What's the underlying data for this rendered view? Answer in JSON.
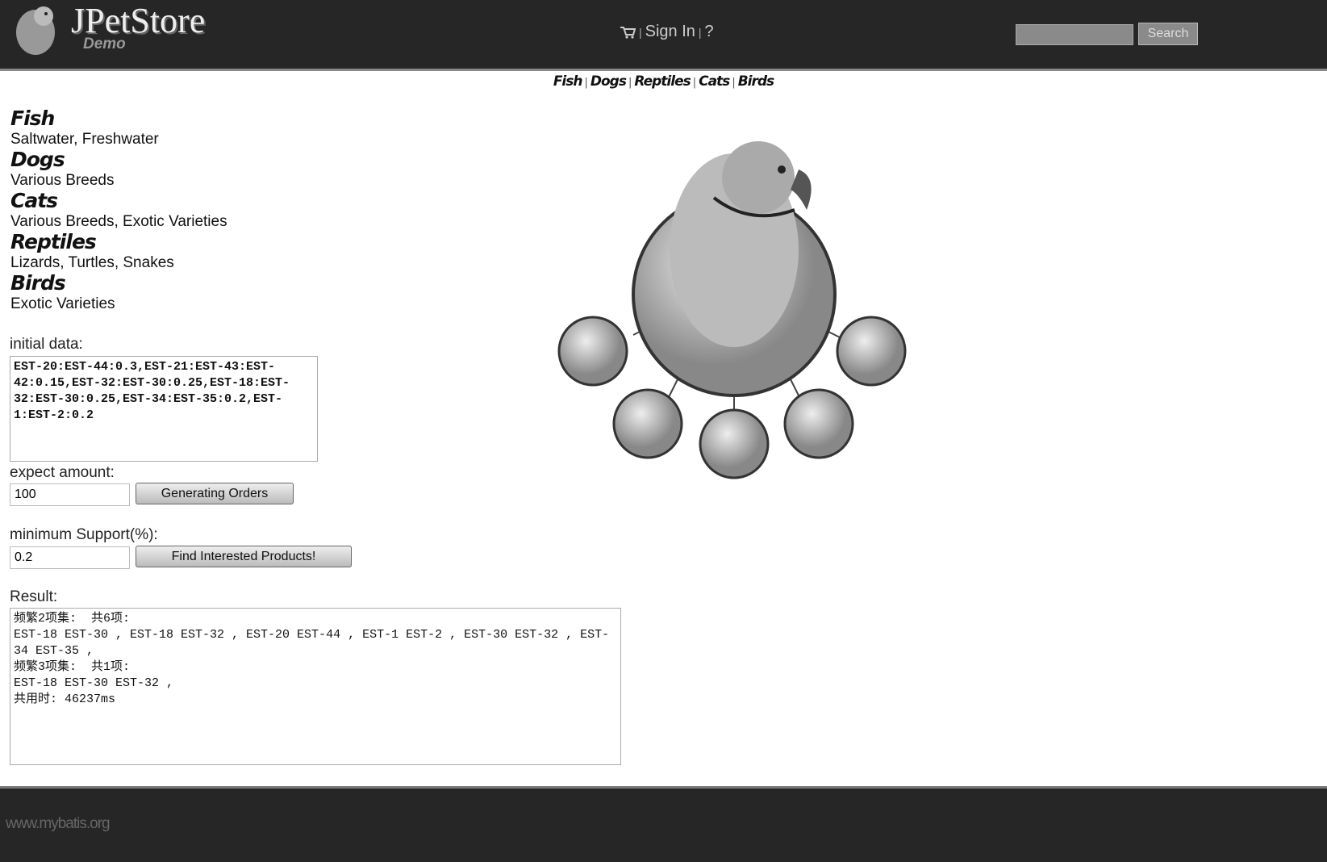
{
  "header": {
    "title": "JPetStore",
    "subtitle": "Demo",
    "cart_icon": "cart-icon",
    "sign_in": "Sign In",
    "help": "?",
    "sep": "|",
    "search_placeholder": "",
    "search_button": "Search"
  },
  "nav": {
    "links": [
      "Fish",
      "Dogs",
      "Reptiles",
      "Cats",
      "Birds"
    ],
    "sep": "|"
  },
  "categories": [
    {
      "name": "Fish",
      "desc": "Saltwater, Freshwater"
    },
    {
      "name": "Dogs",
      "desc": "Various Breeds"
    },
    {
      "name": "Cats",
      "desc": "Various Breeds, Exotic Varieties"
    },
    {
      "name": "Reptiles",
      "desc": "Lizards, Turtles, Snakes"
    },
    {
      "name": "Birds",
      "desc": "Exotic Varieties"
    }
  ],
  "form": {
    "initial_label": "initial data:",
    "initial_value": "EST-20:EST-44:0.3,EST-21:EST-43:EST-42:0.15,EST-32:EST-30:0.25,EST-18:EST-32:EST-30:0.25,EST-34:EST-35:0.2,EST-1:EST-2:0.2",
    "amount_label": "expect amount:",
    "amount_value": "100",
    "generate_button": "Generating Orders",
    "support_label": "minimum Support(%):",
    "support_value": "0.2",
    "find_button": "Find Interested Products!",
    "result_label": "Result:",
    "result_value": "频繁2项集:  共6项:\nEST-18 EST-30 , EST-18 EST-32 , EST-20 EST-44 , EST-1 EST-2 , EST-30 EST-32 , EST-34 EST-35 ,\n频繁3项集:  共1项:\nEST-18 EST-30 EST-32 ,\n共用时: 46237ms"
  },
  "footer": {
    "text": "www.mybatis.org"
  }
}
